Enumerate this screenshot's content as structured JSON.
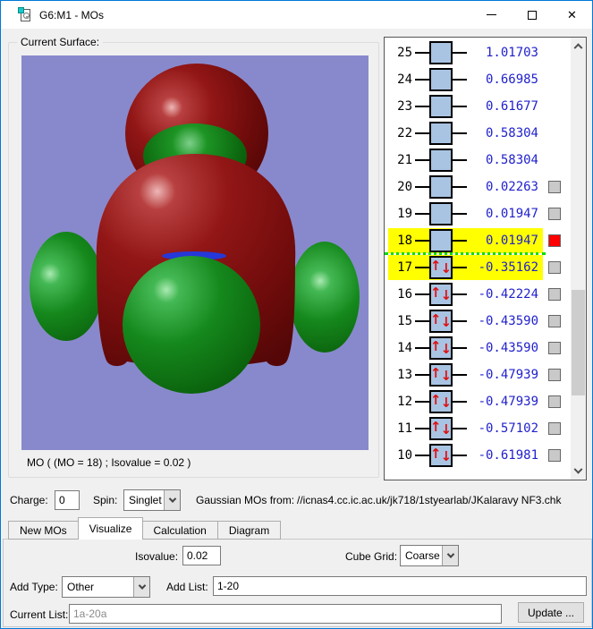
{
  "window": {
    "title": "G6:M1 - MOs"
  },
  "surface": {
    "group_label": "Current Surface:",
    "caption": "MO ( (MO = 18) ; Isovalue = 0.02 )"
  },
  "mo_list": {
    "rows": [
      {
        "num": 25,
        "energy": "1.01703",
        "occupied": false,
        "highlight": false,
        "checkbox": null
      },
      {
        "num": 24,
        "energy": "0.66985",
        "occupied": false,
        "highlight": false,
        "checkbox": null
      },
      {
        "num": 23,
        "energy": "0.61677",
        "occupied": false,
        "highlight": false,
        "checkbox": null
      },
      {
        "num": 22,
        "energy": "0.58304",
        "occupied": false,
        "highlight": false,
        "checkbox": null
      },
      {
        "num": 21,
        "energy": "0.58304",
        "occupied": false,
        "highlight": false,
        "checkbox": null
      },
      {
        "num": 20,
        "energy": "0.02263",
        "occupied": false,
        "highlight": false,
        "checkbox": "gray"
      },
      {
        "num": 19,
        "energy": "0.01947",
        "occupied": false,
        "highlight": false,
        "checkbox": "gray"
      },
      {
        "num": 18,
        "energy": "0.01947",
        "occupied": false,
        "highlight": true,
        "checkbox": "red"
      },
      {
        "num": 17,
        "energy": "-0.35162",
        "occupied": true,
        "highlight": true,
        "checkbox": "gray",
        "separator_above": true
      },
      {
        "num": 16,
        "energy": "-0.42224",
        "occupied": true,
        "highlight": false,
        "checkbox": "gray"
      },
      {
        "num": 15,
        "energy": "-0.43590",
        "occupied": true,
        "highlight": false,
        "checkbox": "gray"
      },
      {
        "num": 14,
        "energy": "-0.43590",
        "occupied": true,
        "highlight": false,
        "checkbox": "gray"
      },
      {
        "num": 13,
        "energy": "-0.47939",
        "occupied": true,
        "highlight": false,
        "checkbox": "gray"
      },
      {
        "num": 12,
        "energy": "-0.47939",
        "occupied": true,
        "highlight": false,
        "checkbox": "gray"
      },
      {
        "num": 11,
        "energy": "-0.57102",
        "occupied": true,
        "highlight": false,
        "checkbox": "gray"
      },
      {
        "num": 10,
        "energy": "-0.61981",
        "occupied": true,
        "highlight": false,
        "checkbox": "gray"
      }
    ]
  },
  "info_bar": {
    "charge_label": "Charge:",
    "charge_value": "0",
    "spin_label": "Spin:",
    "spin_value": "Singlet",
    "source_label": "Gaussian MOs from:",
    "source_path": "//icnas4.cc.ic.ac.uk/jk718/1styearlab/JKalaravy NF3.chk"
  },
  "tabs": [
    {
      "label": "New MOs",
      "active": false
    },
    {
      "label": "Visualize",
      "active": true
    },
    {
      "label": "Calculation",
      "active": false
    },
    {
      "label": "Diagram",
      "active": false
    }
  ],
  "visualize_panel": {
    "isovalue_label": "Isovalue:",
    "isovalue_value": "0.02",
    "cube_grid_label": "Cube Grid:",
    "cube_grid_value": "Coarse",
    "add_type_label": "Add Type:",
    "add_type_value": "Other",
    "add_list_label": "Add List:",
    "add_list_value": "1-20",
    "current_list_label": "Current List:",
    "current_list_value": "1a-20a",
    "update_button_label": "Update ..."
  },
  "colors": {
    "accent": "#0078d7",
    "viewport_background": "#8889cc",
    "surface_positive_red": "#8e1313",
    "surface_negative_green": "#15881c",
    "energy_text": "#2121cd",
    "orbital_box_fill": "#a9c4e3",
    "selection_highlight": "#ffff00",
    "homo_lumo_separator": "#00dd00",
    "selected_checkbox": "#ff0000"
  }
}
